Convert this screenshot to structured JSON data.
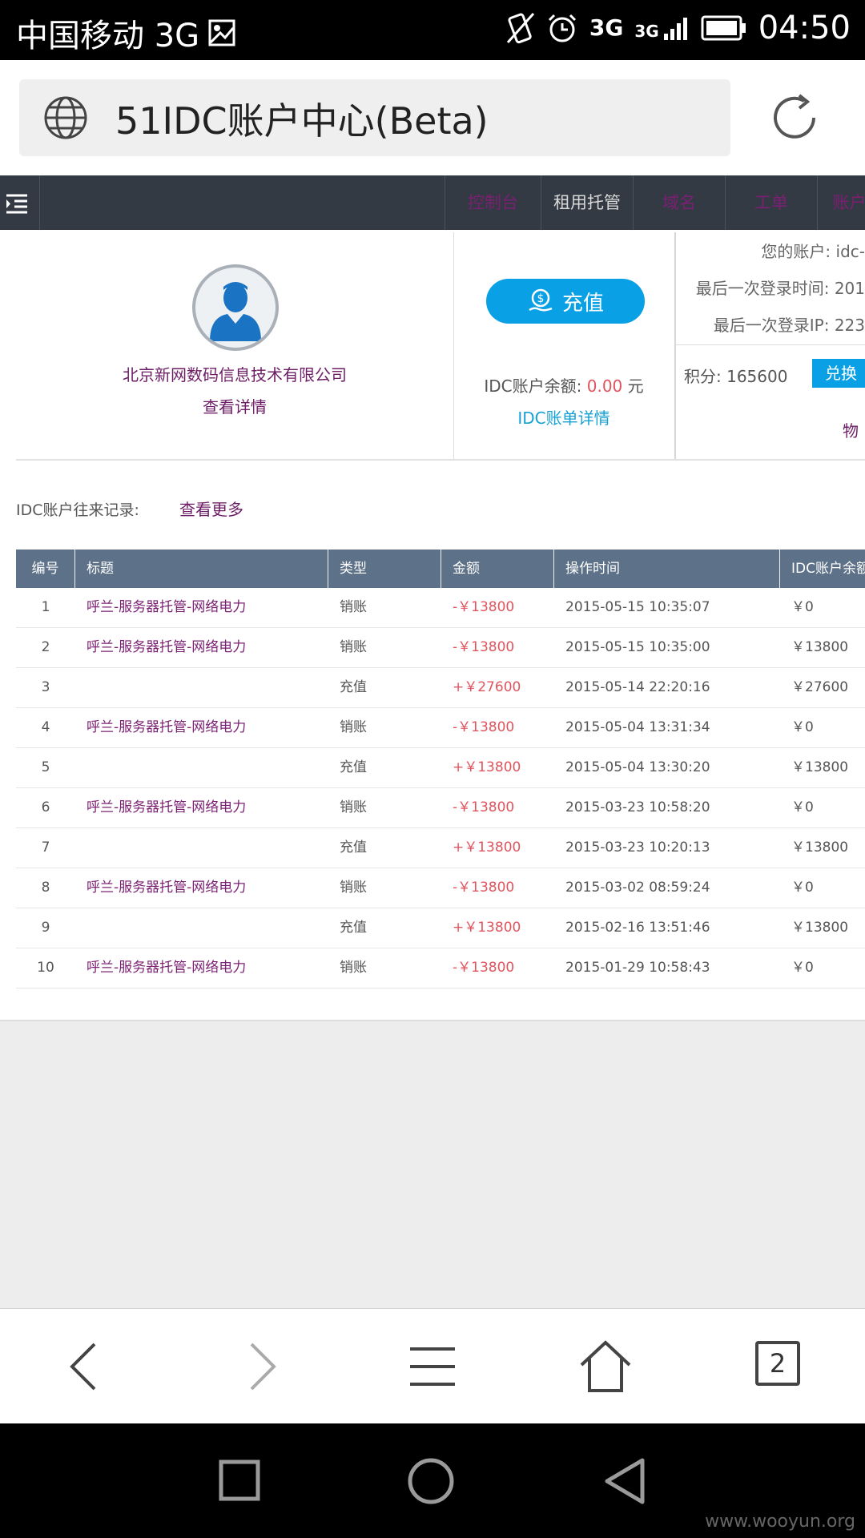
{
  "status_bar": {
    "carrier": "中国移动 3G",
    "net1": "3G",
    "net2": "3G",
    "time": "04:50"
  },
  "browser": {
    "page_title": "51IDC账户中心(Beta)",
    "tab_count": "2"
  },
  "nav": {
    "items": [
      {
        "label": "控制台"
      },
      {
        "label": "租用托管"
      },
      {
        "label": "域名"
      },
      {
        "label": "工单"
      },
      {
        "label": "账户"
      }
    ]
  },
  "profile": {
    "company": "北京新网数码信息技术有限公司",
    "detail_link": "查看详情"
  },
  "wallet": {
    "recharge_label": "充值",
    "balance_label": "IDC账户余额:",
    "balance_value": "0.00",
    "balance_unit": "元",
    "bill_link": "IDC账单详情"
  },
  "account": {
    "account_row": "您的账户:  idc-",
    "last_login_time_row": "最后一次登录时间:  201",
    "last_login_ip_row": "最后一次登录IP:  223",
    "points_row": "积分:  165600",
    "exchange_label": "兑换",
    "goods_link": "物"
  },
  "records": {
    "label": "IDC账户往来记录:",
    "more_link": "查看更多",
    "columns": [
      "编号",
      "标题",
      "类型",
      "金额",
      "操作时间",
      "IDC账户余额"
    ],
    "rows": [
      {
        "no": "1",
        "title": "呼兰-服务器托管-网络电力",
        "type": "销账",
        "amount": "-￥13800",
        "time": "2015-05-15 10:35:07",
        "balance": "￥0"
      },
      {
        "no": "2",
        "title": "呼兰-服务器托管-网络电力",
        "type": "销账",
        "amount": "-￥13800",
        "time": "2015-05-15 10:35:00",
        "balance": "￥13800"
      },
      {
        "no": "3",
        "title": "",
        "type": "充值",
        "amount": "+￥27600",
        "time": "2015-05-14 22:20:16",
        "balance": "￥27600"
      },
      {
        "no": "4",
        "title": "呼兰-服务器托管-网络电力",
        "type": "销账",
        "amount": "-￥13800",
        "time": "2015-05-04 13:31:34",
        "balance": "￥0"
      },
      {
        "no": "5",
        "title": "",
        "type": "充值",
        "amount": "+￥13800",
        "time": "2015-05-04 13:30:20",
        "balance": "￥13800"
      },
      {
        "no": "6",
        "title": "呼兰-服务器托管-网络电力",
        "type": "销账",
        "amount": "-￥13800",
        "time": "2015-03-23 10:58:20",
        "balance": "￥0"
      },
      {
        "no": "7",
        "title": "",
        "type": "充值",
        "amount": "+￥13800",
        "time": "2015-03-23 10:20:13",
        "balance": "￥13800"
      },
      {
        "no": "8",
        "title": "呼兰-服务器托管-网络电力",
        "type": "销账",
        "amount": "-￥13800",
        "time": "2015-03-02 08:59:24",
        "balance": "￥0"
      },
      {
        "no": "9",
        "title": "",
        "type": "充值",
        "amount": "+￥13800",
        "time": "2015-02-16 13:51:46",
        "balance": "￥13800"
      },
      {
        "no": "10",
        "title": "呼兰-服务器托管-网络电力",
        "type": "销账",
        "amount": "-￥13800",
        "time": "2015-01-29 10:58:43",
        "balance": "￥0"
      }
    ]
  },
  "watermark": "www.wooyun.org",
  "colors": {
    "nav_bg": "#343a44",
    "table_header": "#5d7189",
    "link_purple": "#7b1f73",
    "accent_blue": "#0aa0e6",
    "amount_red": "#e0545e"
  }
}
